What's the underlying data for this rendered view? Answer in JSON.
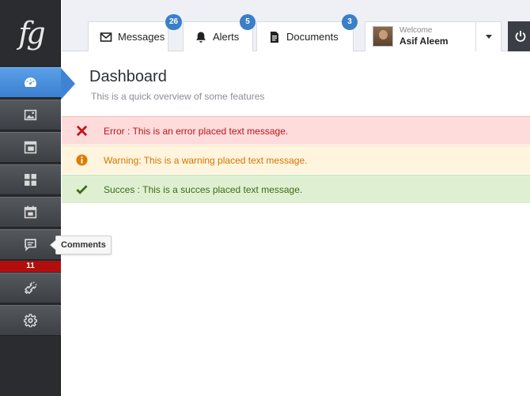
{
  "logo": {
    "text": "fg"
  },
  "sidebar": {
    "items": [
      {
        "name": "dashboard",
        "icon": "gauge-icon"
      },
      {
        "name": "images",
        "icon": "image-icon"
      },
      {
        "name": "layout",
        "icon": "layout-icon"
      },
      {
        "name": "widgets",
        "icon": "grid-icon"
      },
      {
        "name": "calendar",
        "icon": "calendar-icon"
      },
      {
        "name": "comments",
        "icon": "comment-icon"
      },
      {
        "name": "tools",
        "icon": "plug-icon"
      },
      {
        "name": "settings",
        "icon": "gear-icon"
      }
    ],
    "comments_badge": "11",
    "tooltip": "Comments"
  },
  "header": {
    "tabs": [
      {
        "label": "Messages",
        "count": "26",
        "icon": "envelope-icon"
      },
      {
        "label": "Alerts",
        "count": "5",
        "icon": "bell-icon"
      },
      {
        "label": "Documents",
        "count": "3",
        "icon": "document-icon"
      }
    ],
    "user": {
      "welcome": "Welcome",
      "name": "Asif Aleem"
    }
  },
  "page": {
    "title": "Dashboard",
    "subtitle": "This is a quick overview of some features"
  },
  "messages": {
    "error": "Error : This is an error placed text message.",
    "warning": "Warning: This is a warning placed text message.",
    "success": "Succes : This is a succes placed text message."
  },
  "colors": {
    "accent": "#3b7fcf",
    "error": "#b8141b",
    "warning": "#d47400",
    "success": "#3d6b15"
  }
}
